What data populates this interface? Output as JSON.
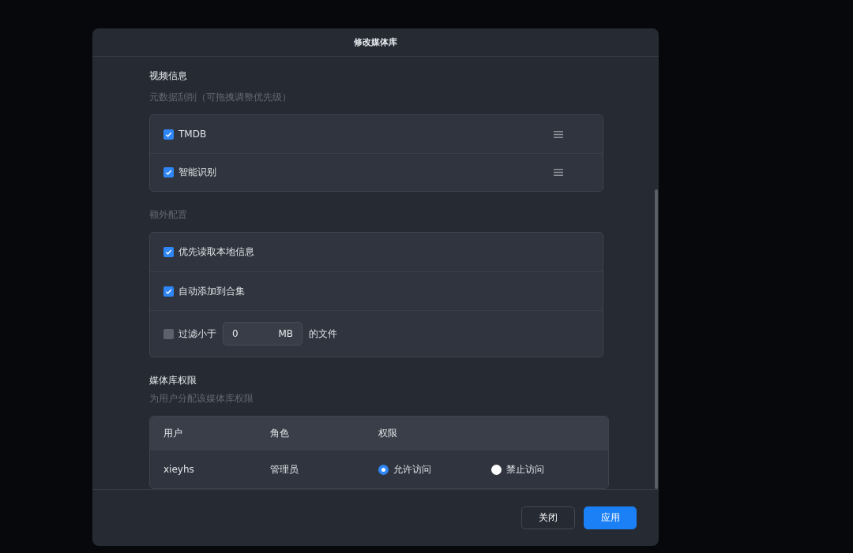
{
  "dialog": {
    "title": "修改媒体库",
    "video_info": {
      "heading": "视频信息",
      "subtitle": "元数据刮削（可拖拽调整优先级）",
      "sources": [
        {
          "label": "TMDB",
          "checked": true
        },
        {
          "label": "智能识别",
          "checked": true
        }
      ]
    },
    "extra": {
      "heading": "额外配置",
      "options": [
        {
          "kind": "check",
          "label": "优先读取本地信息",
          "checked": true
        },
        {
          "kind": "check",
          "label": "自动添加到合集",
          "checked": true
        },
        {
          "kind": "filter",
          "label": "过滤小于",
          "checked": false,
          "value": "0",
          "unit": "MB",
          "suffix": "的文件"
        }
      ]
    },
    "permissions": {
      "heading": "媒体库权限",
      "subtitle": "为用户分配该媒体库权限",
      "columns": [
        "用户",
        "角色",
        "权限"
      ],
      "rows": [
        {
          "user": "xieyhs",
          "role": "管理员",
          "choices": [
            {
              "label": "允许访问",
              "selected": true
            },
            {
              "label": "禁止访问",
              "selected": false
            }
          ]
        }
      ]
    },
    "buttons": [
      {
        "label": "关闭",
        "kind": "secondary"
      },
      {
        "label": "应用",
        "kind": "primary"
      }
    ]
  }
}
